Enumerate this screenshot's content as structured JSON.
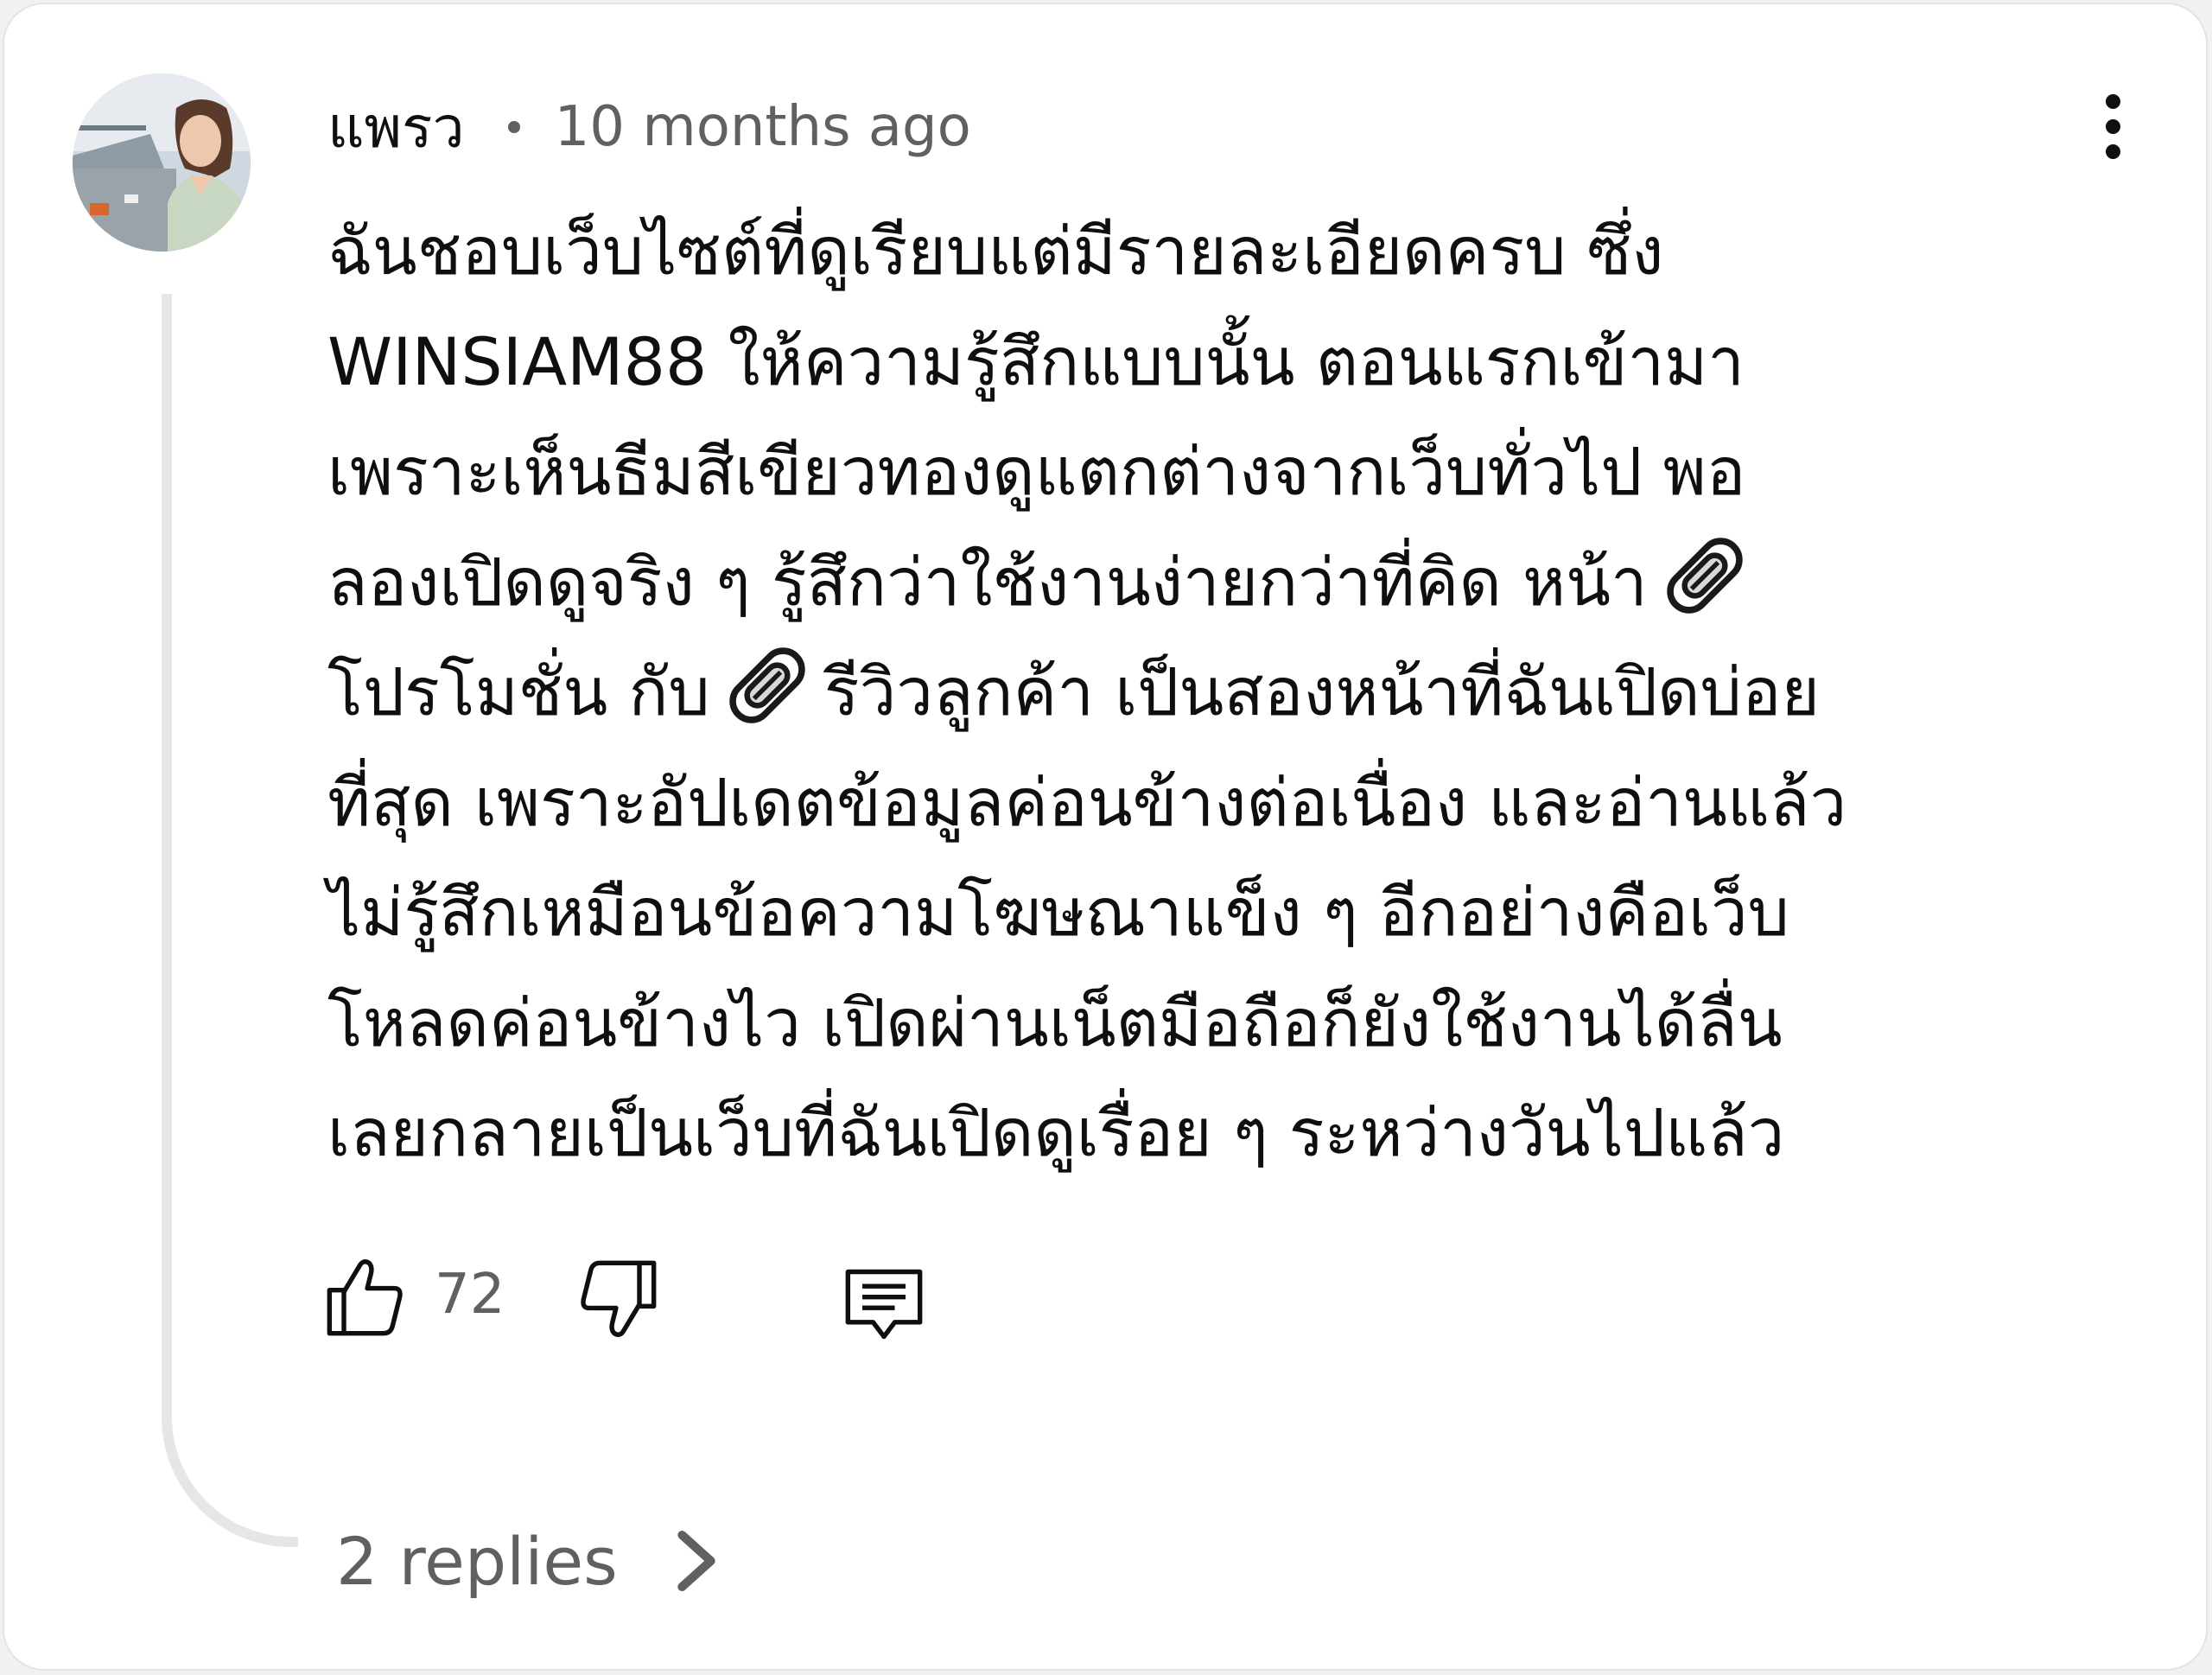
{
  "comment": {
    "author": "แพรว",
    "timestamp": "10 months ago",
    "body_lines": [
      "ฉันชอบเว็บไซต์ที่ดูเรียบแต่มีรายละเอียดครบ ซึ่ง",
      "WINSIAM88 ให้ความรู้สึกแบบนั้น ตอนแรกเข้ามา",
      "เพราะเห็นธีมสีเขียวทองดูแตกต่างจากเว็บทั่วไป พอ",
      "ลองเปิดดูจริง ๆ รู้สึกว่าใช้งานง่ายกว่าที่คิด หน้า",
      "โปรโมชั่น กับ",
      "รีวิวลูกค้า เป็นสองหน้าที่ฉันเปิดบ่อย",
      "ที่สุด เพราะอัปเดตข้อมูลค่อนข้างต่อเนื่อง และอ่านแล้ว",
      "ไม่รู้สึกเหมือนข้อความโฆษณาแข็ง ๆ อีกอย่างคือเว็บ",
      "โหลดค่อนข้างไว เปิดผ่านเน็ตมือถือก็ยังใช้งานได้ลื่น",
      "เลยกลายเป็นเว็บที่ฉันเปิดดูเรื่อย ๆ ระหว่างวันไปแล้ว"
    ],
    "like_count": "72",
    "replies_label": "2 replies"
  },
  "icons": {
    "avatar": "avatar-photo",
    "more": "more-vertical-icon",
    "link": "link-icon",
    "like": "thumbs-up-icon",
    "dislike": "thumbs-down-icon",
    "reply": "comment-reply-icon",
    "chevron": "chevron-right-icon"
  },
  "colors": {
    "text_primary": "#0f0f0f",
    "text_secondary": "#606060",
    "thread_line": "#e6e6e6",
    "background": "#ffffff"
  }
}
